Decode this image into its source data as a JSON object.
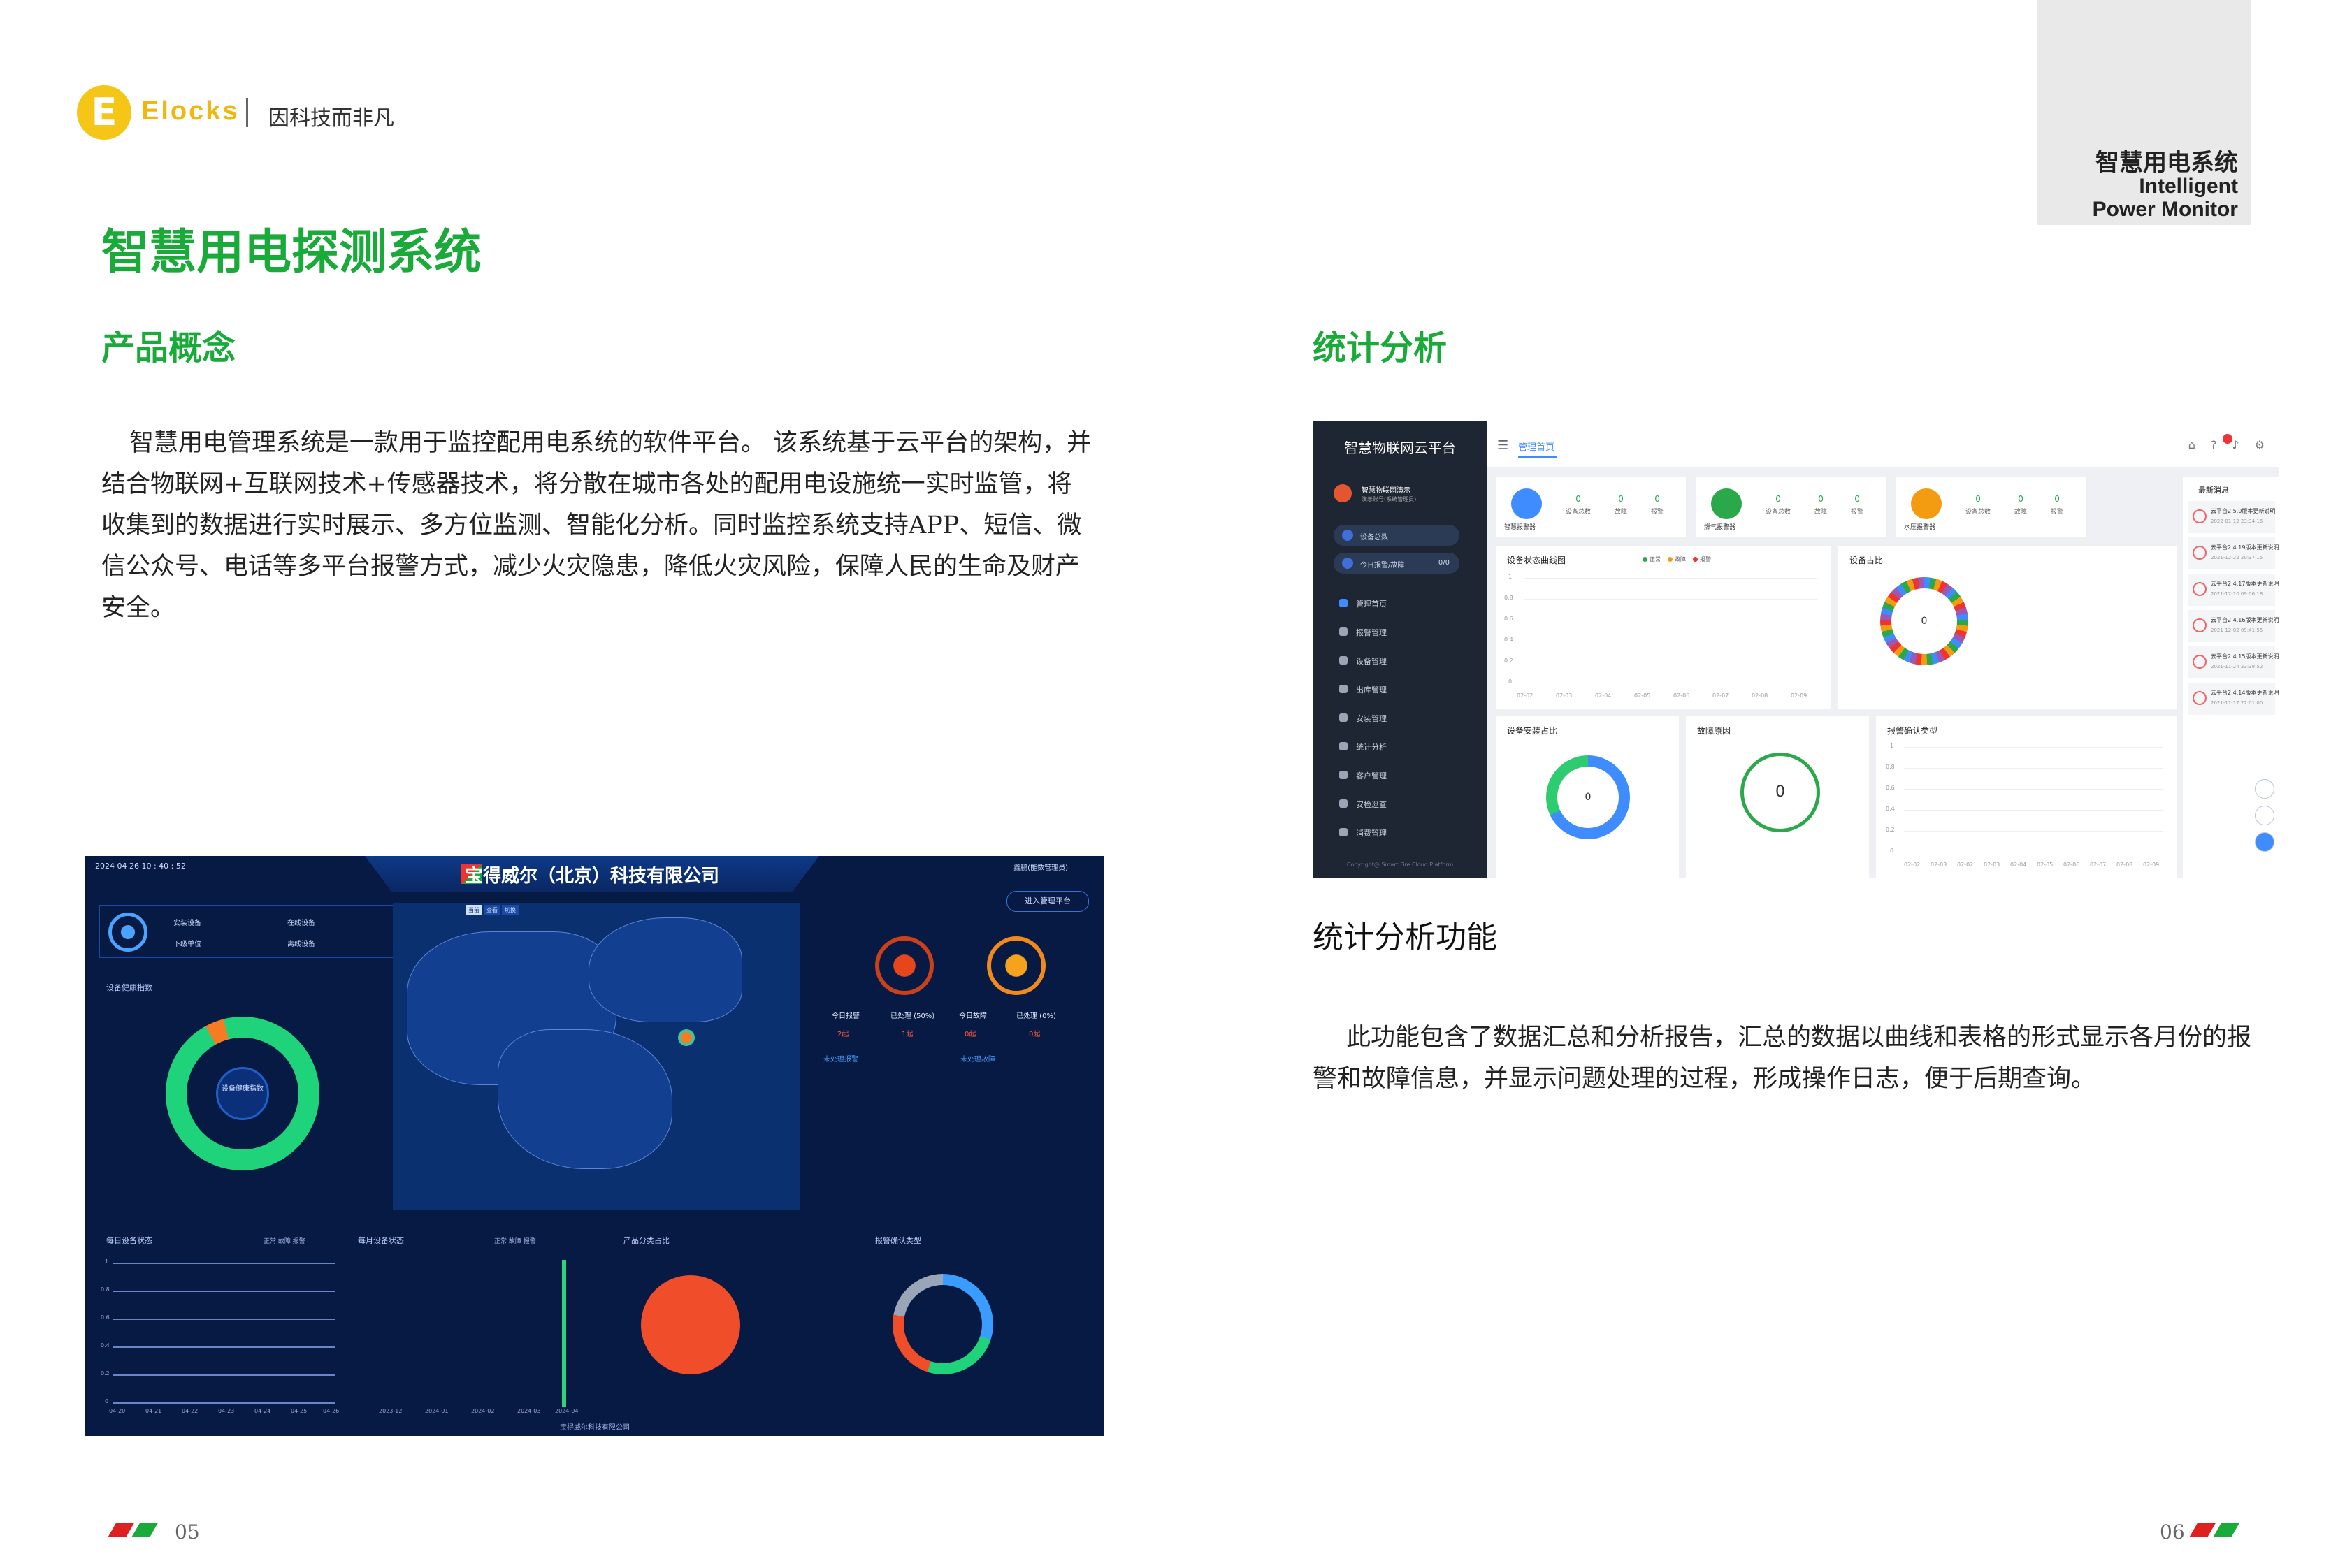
{
  "header": {
    "brand": "Elocks",
    "slogan": "因科技而非凡",
    "corner": {
      "title": "智慧用电系统",
      "en_line1": "Intelligent",
      "en_line2": "Power Monitor"
    }
  },
  "page_title": "智慧用电探测系统",
  "left": {
    "heading": "产品概念",
    "paragraph": "智慧用电管理系统是一款用于监控配用电系统的软件平台。 该系统基于云平台的架构，并结合物联网+互联网技术+传感器技术，将分散在城市各处的配用电设施统一实时监管，将收集到的数据进行实时展示、多方位监测、智能化分析。同时监控系统支持APP、短信、微信公众号、电话等多平台报警方式，减少火灾隐患，降低火灾风险，保障人民的生命及财产安全。"
  },
  "right": {
    "heading": "统计分析",
    "sub_heading": "统计分析功能",
    "paragraph": "此功能包含了数据汇总和分析报告，汇总的数据以曲线和表格的形式显示各月份的报警和故障信息，并显示问题处理的过程，形成操作日志，便于后期查询。"
  },
  "cloud_screen": {
    "brand": "智慧物联网云平台",
    "user_name": "智慧物联网演示",
    "user_sub": "演示账号(系统管理员)",
    "pill_device": "设备总数",
    "pill_alarm": "今日报警/故障",
    "pill_alarm_count": "0/0",
    "nav": [
      "管理首页",
      "报警管理",
      "设备管理",
      "出库管理",
      "安装管理",
      "统计分析",
      "客户管理",
      "安检巡查",
      "消费管理"
    ],
    "footer": "Copyright@ Smart Fire Cloud Platform",
    "tab": "管理首页",
    "stat_cards": [
      {
        "label": "智慧报警器",
        "color": "#3f8cff",
        "values": [
          "0",
          "0",
          "0"
        ],
        "value_labels": [
          "设备总数",
          "故障",
          "报警"
        ]
      },
      {
        "label": "燃气报警器",
        "color": "#2aa84a",
        "values": [
          "0",
          "0",
          "0"
        ],
        "value_labels": [
          "设备总数",
          "故障",
          "报警"
        ]
      },
      {
        "label": "水压报警器",
        "color": "#f39c12",
        "values": [
          "0",
          "0",
          "0"
        ],
        "value_labels": [
          "设备总数",
          "故障",
          "报警"
        ]
      }
    ],
    "curve_title": "设备状态曲线图",
    "curve_legend": [
      "正常",
      "故障",
      "报警"
    ],
    "curve_y": [
      "1",
      "0.8",
      "0.6",
      "0.4",
      "0.2",
      "0"
    ],
    "curve_x": [
      "02-02",
      "02-03",
      "02-04",
      "02-05",
      "02-06",
      "02-07",
      "02-08",
      "02-09"
    ],
    "share_title": "设备占比",
    "share_center": "0",
    "install_title": "设备安装占比",
    "install_center": "0",
    "fault_title": "故障原因",
    "fault_center": "0",
    "confirm_title": "报警确认类型",
    "confirm_y": [
      "1",
      "0.8",
      "0.6",
      "0.4",
      "0.2",
      "0"
    ],
    "confirm_x": [
      "02-02",
      "02-03",
      "02-02",
      "02-03",
      "02-04",
      "02-05",
      "02-06",
      "02-07",
      "02-08",
      "02-09"
    ],
    "msg_title": "最新消息",
    "messages": [
      {
        "text": "云平台2.5.0版本更新说明",
        "date": "2022-01-12 23:34:16"
      },
      {
        "text": "云平台2.4.19版本更新说明",
        "date": "2021-12-22 20:37:15"
      },
      {
        "text": "云平台2.4.17版本更新说明",
        "date": "2021-12-10 09:06:18"
      },
      {
        "text": "云平台2.4.16版本更新说明",
        "date": "2021-12-02 09:41:55"
      },
      {
        "text": "云平台2.4.15版本更新说明",
        "date": "2021-11-24 23:38:52"
      },
      {
        "text": "云平台2.4.14版本更新说明",
        "date": "2021-11-17 22:01:00"
      }
    ]
  },
  "dash_screen": {
    "title": "宝得威尔（北京）科技有限公司",
    "time": "2024 04 26 10 : 40 : 52",
    "toolbar": "鑫鹏(能数管理员)",
    "enter": "进入管理平台",
    "summary": [
      {
        "label": "安装设备",
        "value": ""
      },
      {
        "label": "在线设备",
        "value": ""
      },
      {
        "label": "下级单位",
        "value": ""
      },
      {
        "label": "离线设备",
        "value": "0"
      }
    ],
    "health_title": "设备健康指数",
    "health_center": "设备健康指数",
    "map_tabs": [
      "当前",
      "查看",
      "切换"
    ],
    "alarm_cols": [
      {
        "label": "今日报警",
        "value": "2起"
      },
      {
        "label": "已处理 (50%)",
        "value": "1起"
      },
      {
        "label": "今日故障",
        "value": "0起"
      },
      {
        "label": "已处理 (0%)",
        "value": "0起"
      }
    ],
    "alarm_links": [
      "未处理报警",
      "未处理故障"
    ],
    "panels": [
      "每日设备状态",
      "每月设备状态",
      "产品分类占比",
      "报警确认类型"
    ],
    "daily_legend": "正常 故障 报警",
    "monthly_legend": "正常 故障 报警",
    "daily_y": [
      "1",
      "0.8",
      "0.6",
      "0.4",
      "0.2",
      "0"
    ],
    "daily_x": [
      "04-20",
      "04-21",
      "04-22",
      "04-23",
      "04-24",
      "04-25",
      "04-26"
    ],
    "monthly_x": [
      "2023-12",
      "2024-01",
      "2024-02",
      "2024-03",
      "2024-04"
    ],
    "footer": "宝得威尔科技有限公司"
  },
  "pages": {
    "left": "05",
    "right": "06"
  },
  "colors": {
    "brand_green": "#1aaa3a",
    "stripe_red": "#e02020",
    "stripe_green": "#1aaa3a"
  }
}
